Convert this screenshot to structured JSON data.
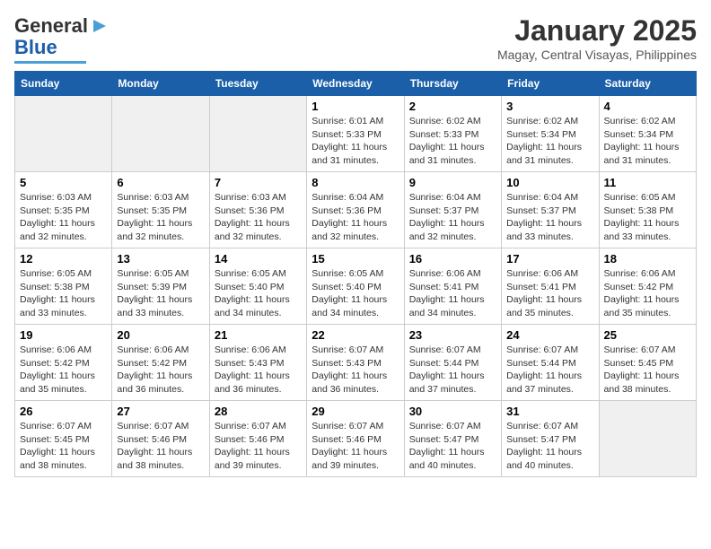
{
  "header": {
    "logo_general": "General",
    "logo_blue": "Blue",
    "month_title": "January 2025",
    "location": "Magay, Central Visayas, Philippines"
  },
  "days_of_week": [
    "Sunday",
    "Monday",
    "Tuesday",
    "Wednesday",
    "Thursday",
    "Friday",
    "Saturday"
  ],
  "weeks": [
    [
      {
        "day": "",
        "empty": true
      },
      {
        "day": "",
        "empty": true
      },
      {
        "day": "",
        "empty": true
      },
      {
        "day": "1",
        "sunrise": "6:01 AM",
        "sunset": "5:33 PM",
        "daylight": "11 hours and 31 minutes."
      },
      {
        "day": "2",
        "sunrise": "6:02 AM",
        "sunset": "5:33 PM",
        "daylight": "11 hours and 31 minutes."
      },
      {
        "day": "3",
        "sunrise": "6:02 AM",
        "sunset": "5:34 PM",
        "daylight": "11 hours and 31 minutes."
      },
      {
        "day": "4",
        "sunrise": "6:02 AM",
        "sunset": "5:34 PM",
        "daylight": "11 hours and 31 minutes."
      }
    ],
    [
      {
        "day": "5",
        "sunrise": "6:03 AM",
        "sunset": "5:35 PM",
        "daylight": "11 hours and 32 minutes."
      },
      {
        "day": "6",
        "sunrise": "6:03 AM",
        "sunset": "5:35 PM",
        "daylight": "11 hours and 32 minutes."
      },
      {
        "day": "7",
        "sunrise": "6:03 AM",
        "sunset": "5:36 PM",
        "daylight": "11 hours and 32 minutes."
      },
      {
        "day": "8",
        "sunrise": "6:04 AM",
        "sunset": "5:36 PM",
        "daylight": "11 hours and 32 minutes."
      },
      {
        "day": "9",
        "sunrise": "6:04 AM",
        "sunset": "5:37 PM",
        "daylight": "11 hours and 32 minutes."
      },
      {
        "day": "10",
        "sunrise": "6:04 AM",
        "sunset": "5:37 PM",
        "daylight": "11 hours and 33 minutes."
      },
      {
        "day": "11",
        "sunrise": "6:05 AM",
        "sunset": "5:38 PM",
        "daylight": "11 hours and 33 minutes."
      }
    ],
    [
      {
        "day": "12",
        "sunrise": "6:05 AM",
        "sunset": "5:38 PM",
        "daylight": "11 hours and 33 minutes."
      },
      {
        "day": "13",
        "sunrise": "6:05 AM",
        "sunset": "5:39 PM",
        "daylight": "11 hours and 33 minutes."
      },
      {
        "day": "14",
        "sunrise": "6:05 AM",
        "sunset": "5:40 PM",
        "daylight": "11 hours and 34 minutes."
      },
      {
        "day": "15",
        "sunrise": "6:05 AM",
        "sunset": "5:40 PM",
        "daylight": "11 hours and 34 minutes."
      },
      {
        "day": "16",
        "sunrise": "6:06 AM",
        "sunset": "5:41 PM",
        "daylight": "11 hours and 34 minutes."
      },
      {
        "day": "17",
        "sunrise": "6:06 AM",
        "sunset": "5:41 PM",
        "daylight": "11 hours and 35 minutes."
      },
      {
        "day": "18",
        "sunrise": "6:06 AM",
        "sunset": "5:42 PM",
        "daylight": "11 hours and 35 minutes."
      }
    ],
    [
      {
        "day": "19",
        "sunrise": "6:06 AM",
        "sunset": "5:42 PM",
        "daylight": "11 hours and 35 minutes."
      },
      {
        "day": "20",
        "sunrise": "6:06 AM",
        "sunset": "5:42 PM",
        "daylight": "11 hours and 36 minutes."
      },
      {
        "day": "21",
        "sunrise": "6:06 AM",
        "sunset": "5:43 PM",
        "daylight": "11 hours and 36 minutes."
      },
      {
        "day": "22",
        "sunrise": "6:07 AM",
        "sunset": "5:43 PM",
        "daylight": "11 hours and 36 minutes."
      },
      {
        "day": "23",
        "sunrise": "6:07 AM",
        "sunset": "5:44 PM",
        "daylight": "11 hours and 37 minutes."
      },
      {
        "day": "24",
        "sunrise": "6:07 AM",
        "sunset": "5:44 PM",
        "daylight": "11 hours and 37 minutes."
      },
      {
        "day": "25",
        "sunrise": "6:07 AM",
        "sunset": "5:45 PM",
        "daylight": "11 hours and 38 minutes."
      }
    ],
    [
      {
        "day": "26",
        "sunrise": "6:07 AM",
        "sunset": "5:45 PM",
        "daylight": "11 hours and 38 minutes."
      },
      {
        "day": "27",
        "sunrise": "6:07 AM",
        "sunset": "5:46 PM",
        "daylight": "11 hours and 38 minutes."
      },
      {
        "day": "28",
        "sunrise": "6:07 AM",
        "sunset": "5:46 PM",
        "daylight": "11 hours and 39 minutes."
      },
      {
        "day": "29",
        "sunrise": "6:07 AM",
        "sunset": "5:46 PM",
        "daylight": "11 hours and 39 minutes."
      },
      {
        "day": "30",
        "sunrise": "6:07 AM",
        "sunset": "5:47 PM",
        "daylight": "11 hours and 40 minutes."
      },
      {
        "day": "31",
        "sunrise": "6:07 AM",
        "sunset": "5:47 PM",
        "daylight": "11 hours and 40 minutes."
      },
      {
        "day": "",
        "empty": true
      }
    ]
  ]
}
